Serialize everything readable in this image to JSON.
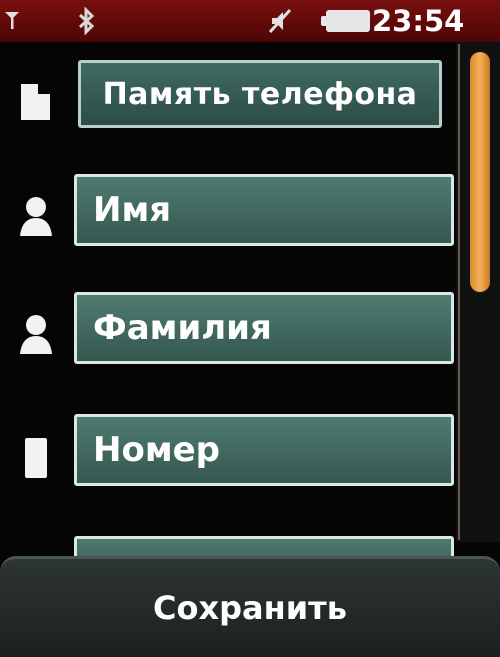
{
  "status_bar": {
    "time": "23:54",
    "icons": [
      "signal-icon",
      "bluetooth-icon",
      "silent-mode-icon",
      "battery-icon"
    ]
  },
  "form": {
    "storage_label": "Память телефона",
    "first_name_placeholder": "Имя",
    "last_name_placeholder": "Фамилия",
    "number_placeholder": "Номер"
  },
  "softkeys": {
    "save_label": "Сохранить"
  },
  "colors": {
    "status_bar": "#6a0a0a",
    "field_fill": "#466e64",
    "field_border": "#d9e8e3",
    "scroll_thumb": "#e39a3c",
    "background": "#060606"
  }
}
